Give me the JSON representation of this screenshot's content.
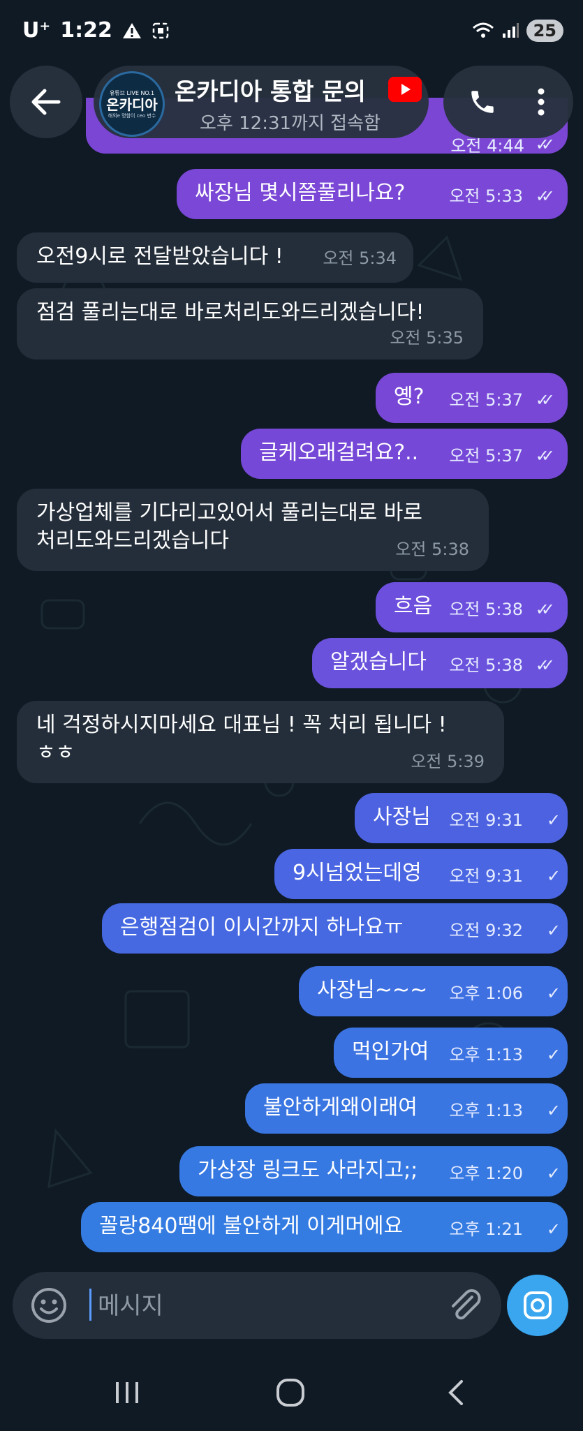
{
  "status_bar": {
    "carrier": "U⁺",
    "time": "1:22",
    "battery": "25"
  },
  "header": {
    "title": "온카디아 통합 문의",
    "subtitle": "오후 12:31까지 접속함",
    "avatar": {
      "top": "유튜브 LIVE NO.1",
      "main": "온카디아",
      "sub": "해외e 명함이 ceo 변수"
    }
  },
  "messages": [
    {
      "dir": "out",
      "text": "싸장님 몇시쯤풀리나요?",
      "time": "오전 5:33",
      "read": true,
      "color": "#7a47d6"
    },
    {
      "dir": "in",
      "text": "오전9시로 전달받았습니다 !",
      "time": "오전 5:34"
    },
    {
      "dir": "in",
      "text": "점검 풀리는대로 바로처리도와드리겠습니다!",
      "time": "오전 5:35"
    },
    {
      "dir": "out",
      "text": "옝?",
      "time": "오전 5:37",
      "read": true,
      "color": "#7847d6"
    },
    {
      "dir": "out",
      "text": "글케오래걸려요?..",
      "time": "오전 5:37",
      "read": true,
      "color": "#7648d7"
    },
    {
      "dir": "in",
      "text_lines": [
        "가상업체를 기다리고있어서 풀리는대로 바로",
        "처리도와드리겠습니다"
      ],
      "time": "오전 5:38"
    },
    {
      "dir": "out",
      "text": "흐음",
      "time": "오전 5:38",
      "read": true,
      "color": "#6c4fdc"
    },
    {
      "dir": "out",
      "text": "알겠습니다",
      "time": "오전 5:38",
      "read": true,
      "color": "#6a52dd"
    },
    {
      "dir": "in",
      "text_lines": [
        "네 걱정하시지마세요 대표님 ! 꼭 처리 됩니다 !",
        "ㅎㅎ"
      ],
      "time": "오전 5:39"
    },
    {
      "dir": "out",
      "text": "사장님",
      "time": "오전 9:31",
      "read": false,
      "color": "#4d62e0"
    },
    {
      "dir": "out",
      "text": "9시넘었는데영",
      "time": "오전 9:31",
      "read": false,
      "color": "#4a66e2"
    },
    {
      "dir": "out",
      "text": "은행점검이 이시간까지 하나요ㅠ",
      "time": "오전 9:32",
      "read": false,
      "color": "#4669e2"
    },
    {
      "dir": "out",
      "text": "사장님~~~",
      "time": "오후 1:06",
      "read": false,
      "color": "#3f70e2"
    },
    {
      "dir": "out",
      "text": "먹인가여",
      "time": "오후 1:13",
      "read": false,
      "color": "#3c73e2"
    },
    {
      "dir": "out",
      "text": "불안하게왜이래여",
      "time": "오후 1:13",
      "read": false,
      "color": "#3a76e2"
    },
    {
      "dir": "out",
      "text": "가상장 링크도 사라지고;;",
      "time": "오후 1:20",
      "read": false,
      "color": "#3779e2"
    },
    {
      "dir": "out",
      "text": "꼴랑840땜에 불안하게 이게머에요",
      "time": "오후 1:21",
      "read": false,
      "color": "#347ce2"
    }
  ],
  "partial_top": {
    "time": "오전 4:44"
  },
  "input": {
    "placeholder": "메시지"
  },
  "colors": {
    "incoming": "#232e3a",
    "background": "#0f1a25",
    "camera": "#3aa6ef"
  }
}
